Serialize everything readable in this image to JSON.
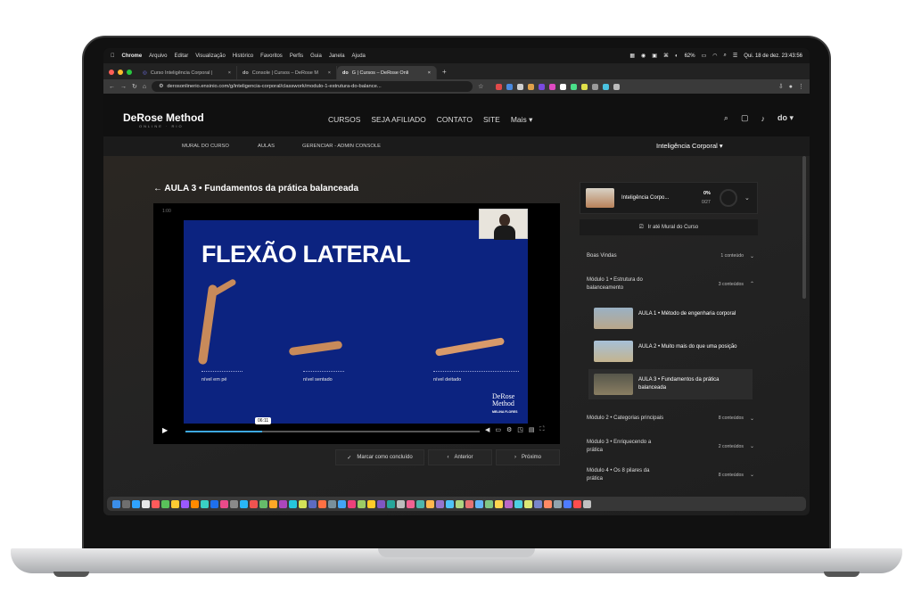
{
  "menubar": {
    "app": "Chrome",
    "items": [
      "Arquivo",
      "Editar",
      "Visualização",
      "Histórico",
      "Favoritos",
      "Perfis",
      "Guia",
      "Janela",
      "Ajuda"
    ],
    "battery": "62%",
    "datetime": "Qui. 18 de dez.  23:43:56"
  },
  "tabs": [
    {
      "title": "Curso Inteligência Corporal |"
    },
    {
      "title": "Console | Cursos – DeRose M"
    },
    {
      "title": "G | Cursos – DeRose Onli"
    }
  ],
  "addressbar": {
    "url": "derosonlinerio.ensinio.com/g/inteligencia-corporal/classwork/modulo-1-estrutura-do-balance..."
  },
  "site": {
    "logo": "DeRose Method",
    "logo_sub": "ONLINE · RIO",
    "nav": [
      "CURSOS",
      "SEJA AFILIADO",
      "CONTATO",
      "SITE",
      "Mais"
    ],
    "user_badge": "do",
    "subnav": [
      "MURAL DO CURSO",
      "AULAS",
      "GERENCIAR - ADMIN CONSOLE"
    ],
    "course_selector": "Inteligência Corporal"
  },
  "lesson": {
    "title": "AULA 3 • Fundamentos da prática balanceada",
    "time_label": "1:00",
    "slide_title": "FLEXÃO LATERAL",
    "poses": [
      "nível em pé",
      "nível sentado",
      "nível deitado"
    ],
    "slide_brand": "DeRose Method",
    "slide_author": "MELINA FLORES",
    "current_time": "06:11",
    "progress": 0.26,
    "buttons": {
      "complete": "Marcar como concluído",
      "prev": "Anterior",
      "next": "Próximo"
    }
  },
  "sidebar": {
    "course_name": "Inteligência Corpo...",
    "progress_percent": "0%",
    "progress_count": "0/27",
    "mural_button": "Ir até Mural do Curso",
    "modules": [
      {
        "title": "Boas Vindas",
        "count": "1 conteúdo"
      },
      {
        "title": "Módulo 1 • Estrutura do balanceamento",
        "count": "3 conteúdos"
      },
      {
        "title": "Módulo 2 • Categorias principais",
        "count": "8 conteúdos"
      },
      {
        "title": "Módulo 3 • Enriquecendo a prática",
        "count": "2 conteúdos"
      },
      {
        "title": "Módulo 4 • Os 8 pilares da prática",
        "count": "8 conteúdos"
      }
    ],
    "lessons": [
      {
        "title": "AULA 1 • Método de engenharia corporal"
      },
      {
        "title": "AULA 2 • Muito mais do que uma posição"
      },
      {
        "title": "AULA 3 • Fundamentos da prática balanceada"
      }
    ]
  },
  "colors": {
    "slide_bg": "#0c2380",
    "progress_accent": "#3da8e0"
  }
}
